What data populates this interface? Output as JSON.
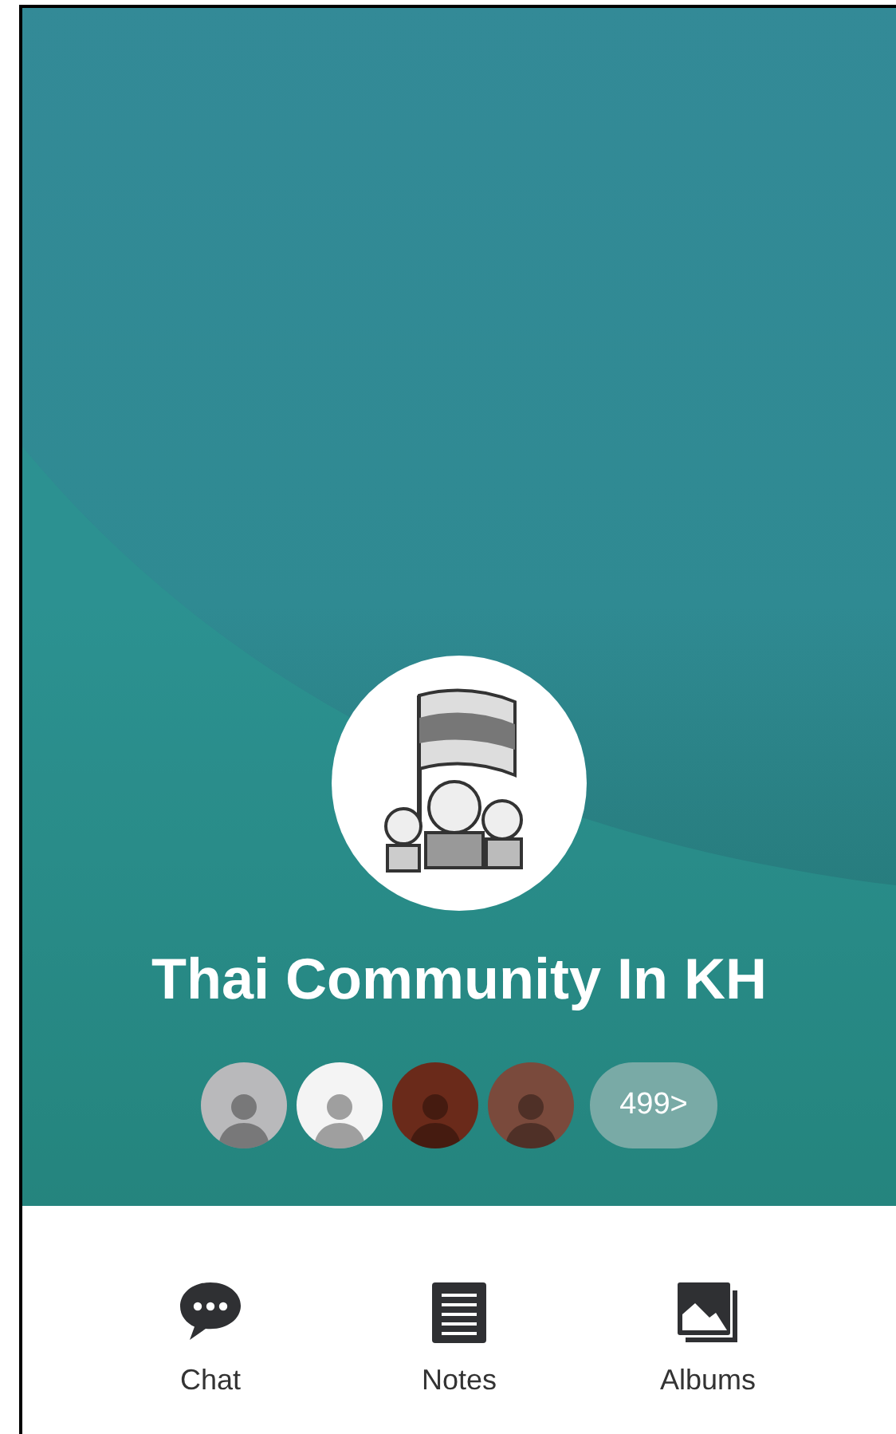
{
  "group": {
    "name": "Thai Community In KH"
  },
  "members": {
    "count": "499>"
  },
  "tabs": [
    {
      "label": "Chat",
      "kind": "chat"
    },
    {
      "label": "Notes",
      "kind": "notes"
    },
    {
      "label": "Albums",
      "kind": "albums"
    }
  ]
}
